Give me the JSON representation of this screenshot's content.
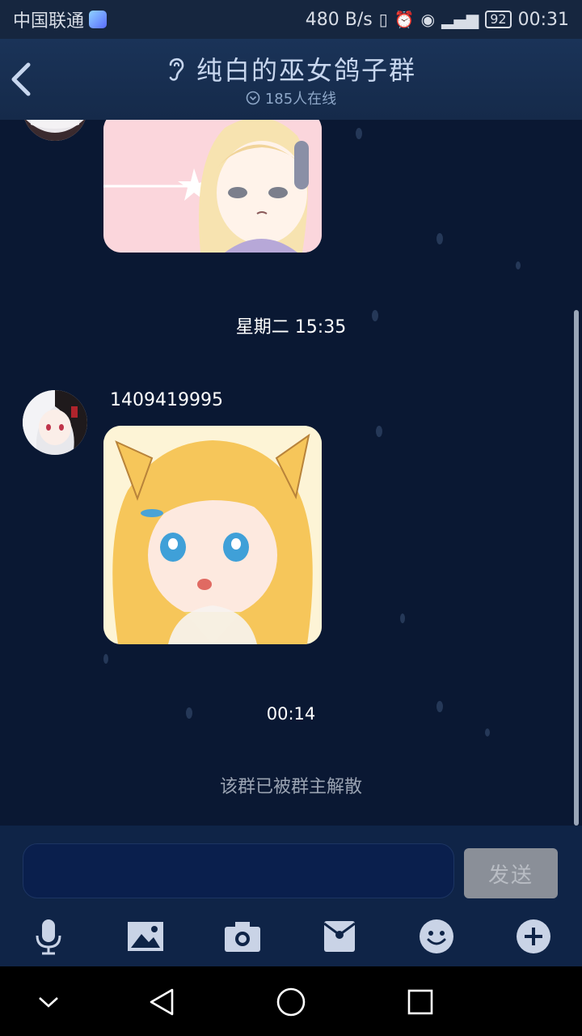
{
  "status_bar": {
    "carrier": "中国联通",
    "net_speed": "480 B/s",
    "battery": "92",
    "time": "00:31"
  },
  "header": {
    "title": "纯白的巫女鸽子群",
    "online": "185人在线",
    "title_icon": "ear-icon",
    "online_icon": "chevron-circle-icon"
  },
  "chat": {
    "timestamp_1": "星期二 15:35",
    "sender_name": "1409419995",
    "timestamp_2": "00:14",
    "system_notice": "该群已被群主解散"
  },
  "composer": {
    "input_value": "",
    "send_label": "发送"
  },
  "toolbar": {
    "icons": [
      "microphone-icon",
      "image-icon",
      "camera-icon",
      "red-packet-icon",
      "emoji-icon",
      "plus-icon"
    ]
  },
  "colors": {
    "background": "#0b1a33",
    "header": "#1a3358",
    "toolbar": "#0f2447",
    "icon": "#c9d3e6"
  }
}
